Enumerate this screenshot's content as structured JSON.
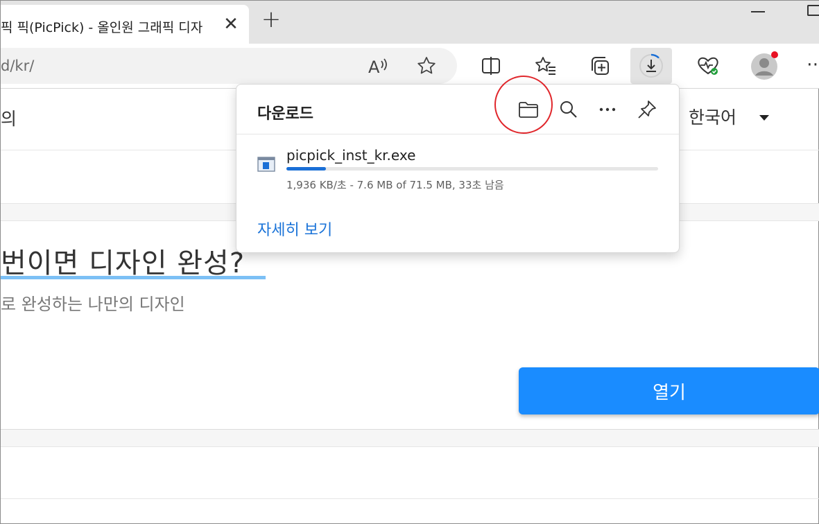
{
  "browser": {
    "tab": {
      "title": "픽 픽(PicPick) - 올인원 그래픽 디자",
      "close": "✕"
    },
    "new_tab": "+",
    "address": {
      "text": "d/kr/"
    }
  },
  "toolbar_icons": [
    "read-aloud-icon",
    "favorite-star-icon",
    "split-screen-icon",
    "favorites-icon",
    "collections-icon",
    "downloads-icon",
    "browser-essentials-icon",
    "profile-icon",
    "more-icon"
  ],
  "page": {
    "nav_text": "의",
    "language": "한국어",
    "headline": "번이면 디자인 완성?",
    "subline": "로 완성하는 나만의 디자인",
    "open_button": "열기"
  },
  "downloads": {
    "title": "다운로드",
    "item": {
      "filename": "picpick_inst_kr.exe",
      "progress": 0.106,
      "status": "1,936 KB/초 - 7.6 MB of 71.5 MB, 33초 남음"
    },
    "see_more": "자세히 보기"
  },
  "colors": {
    "accent": "#1a8cff",
    "link": "#1a73d8",
    "highlight_circle": "#e0262b",
    "progress": "#1a6fd6"
  }
}
